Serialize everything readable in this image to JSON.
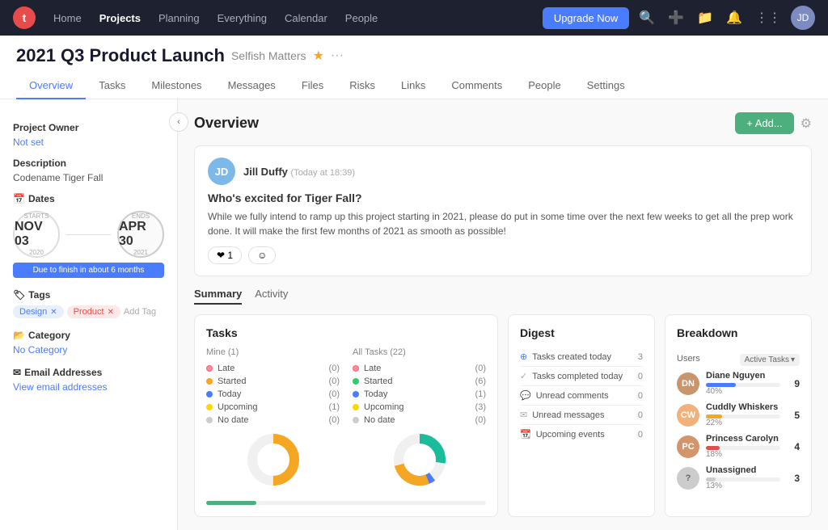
{
  "topnav": {
    "logo": "t",
    "links": [
      {
        "label": "Home",
        "active": false
      },
      {
        "label": "Projects",
        "active": true
      },
      {
        "label": "Planning",
        "active": false
      },
      {
        "label": "Everything",
        "active": false
      },
      {
        "label": "Calendar",
        "active": false
      },
      {
        "label": "People",
        "active": false
      }
    ],
    "upgrade_label": "Upgrade Now",
    "avatar_initials": "JD"
  },
  "project": {
    "title": "2021 Q3 Product Launch",
    "subtitle": "Selfish Matters",
    "star": "★",
    "dots": "···"
  },
  "subnav_tabs": [
    {
      "label": "Overview",
      "active": true
    },
    {
      "label": "Tasks",
      "active": false
    },
    {
      "label": "Milestones",
      "active": false
    },
    {
      "label": "Messages",
      "active": false
    },
    {
      "label": "Files",
      "active": false
    },
    {
      "label": "Risks",
      "active": false
    },
    {
      "label": "Links",
      "active": false
    },
    {
      "label": "Comments",
      "active": false
    },
    {
      "label": "People",
      "active": false
    },
    {
      "label": "Settings",
      "active": false
    }
  ],
  "sidebar": {
    "project_owner_label": "Project Owner",
    "project_owner_value": "Not set",
    "description_label": "Description",
    "description_value": "Codename Tiger Fall",
    "dates_label": "Dates",
    "start_month": "Starts",
    "start_day": "NOV 03",
    "start_year": "2020",
    "end_label": "Ends",
    "end_day": "APR 30",
    "end_year": "2021",
    "due_badge": "Due to finish in about 6 months",
    "tags_label": "Tags",
    "tags": [
      {
        "label": "Design",
        "type": "design"
      },
      {
        "label": "Product",
        "type": "product"
      }
    ],
    "add_tag_label": "Add Tag",
    "category_label": "Category",
    "category_value": "No Category",
    "email_label": "Email Addresses",
    "view_email_label": "View email addresses"
  },
  "content": {
    "title": "Overview",
    "add_button": "+ Add...",
    "post": {
      "author": "Jill Duffy",
      "time": "(Today at 18:39)",
      "title": "Who's excited for Tiger Fall?",
      "body": "While we fully intend to ramp up this project starting in 2021, please do put in some time over the next few weeks to get all the prep work done. It will make the first few months of 2021 as smooth as possible!",
      "reaction_heart": "❤ 1",
      "reaction_emoji": "☺"
    },
    "inner_tabs": [
      {
        "label": "Summary",
        "active": true
      },
      {
        "label": "Activity",
        "active": false
      }
    ],
    "tasks": {
      "title": "Tasks",
      "mine_label": "Mine (1)",
      "all_label": "All Tasks (22)",
      "mine_stats": [
        {
          "label": "Late",
          "count": "(0)",
          "dot": "late"
        },
        {
          "label": "Started",
          "count": "(0)",
          "dot": "started"
        },
        {
          "label": "Today",
          "count": "(0)",
          "dot": "today"
        },
        {
          "label": "Upcoming",
          "count": "(1)",
          "dot": "upcoming"
        },
        {
          "label": "No date",
          "count": "(0)",
          "dot": "nodate"
        }
      ],
      "all_stats": [
        {
          "label": "Late",
          "count": "(0)",
          "dot": "late"
        },
        {
          "label": "Started",
          "count": "(6)",
          "dot": "started-all"
        },
        {
          "label": "Today",
          "count": "(1)",
          "dot": "today"
        },
        {
          "label": "Upcoming",
          "count": "(3)",
          "dot": "upcoming"
        },
        {
          "label": "No date",
          "count": "(0)",
          "dot": "nodate"
        }
      ]
    },
    "digest": {
      "title": "Digest",
      "rows": [
        {
          "label": "Tasks created today",
          "count": "3",
          "icon": "plus"
        },
        {
          "label": "Tasks completed today",
          "count": "0",
          "icon": "check"
        },
        {
          "label": "Unread comments",
          "count": "0",
          "icon": "chat"
        },
        {
          "label": "Unread messages",
          "count": "0",
          "icon": "chat"
        },
        {
          "label": "Upcoming events",
          "count": "0",
          "icon": "calendar"
        }
      ]
    },
    "breakdown": {
      "title": "Breakdown",
      "users_label": "Users",
      "active_tasks_label": "Active Tasks",
      "users": [
        {
          "name": "Diane Nguyen",
          "pct": 40,
          "count": 9,
          "color": "#4a7cff",
          "bg": "#e8a87c"
        },
        {
          "name": "Cuddly Whiskers",
          "pct": 22,
          "count": 5,
          "color": "#f5a623",
          "bg": "#f0b27a"
        },
        {
          "name": "Princess Carolyn",
          "pct": 18,
          "count": 4,
          "color": "#e84b4b",
          "bg": "#d4a76a"
        },
        {
          "name": "Unassigned",
          "pct": 13,
          "count": 3,
          "color": "#ccc",
          "bg": "#ccc"
        }
      ]
    }
  }
}
